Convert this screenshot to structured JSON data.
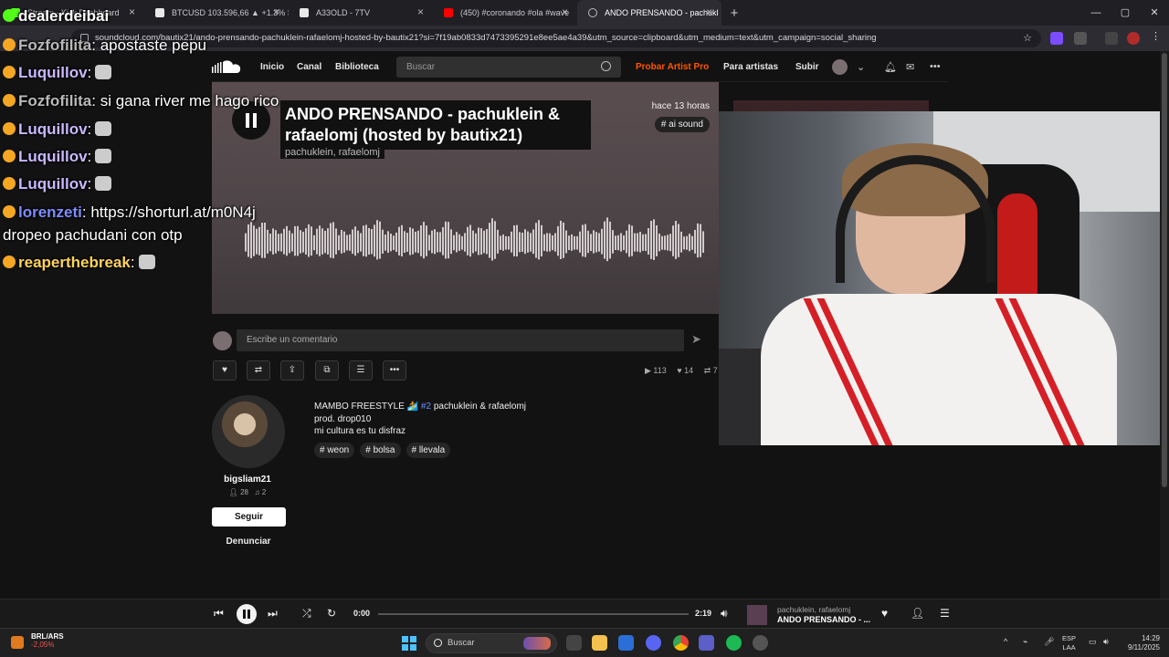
{
  "browser": {
    "tabs": [
      {
        "label": "Stream - Kick Dashboard",
        "icon_color": "#53fc18"
      },
      {
        "label": "BTCUSD 103.596,66 ▲ +1.3% S",
        "icon_color": "#e8e8e8"
      },
      {
        "label": "A33OLD - 7TV",
        "icon_color": "#e8e8e8"
      },
      {
        "label": "(450) #coronando #ola #wave",
        "icon_color": "#ff0000"
      },
      {
        "label": "ANDO PRENSANDO - pachukl",
        "icon_color": "#ff5500"
      }
    ],
    "new_tab": "+",
    "window_controls": [
      "—",
      "▢",
      "✕"
    ],
    "url": "soundcloud.com/bautix21/ando-prensando-pachuklein-rafaelomj-hosted-by-bautix21?si=7f19ab0833d7473395291e8ee5ae4a39&utm_source=clipboard&utm_medium=text&utm_campaign=social_sharing"
  },
  "soundcloud": {
    "nav": {
      "home": "Inicio",
      "feed": "Canal",
      "library": "Biblioteca",
      "search_placeholder": "Buscar",
      "try_pro": "Probar Artist Pro",
      "for_artists": "Para artistas",
      "upload": "Subir"
    },
    "track": {
      "title": "ANDO PRENSANDO - pachuklein & rafaelomj (hosted by bautix21)",
      "artists": "pachuklein, rafaelomj",
      "posted": "hace 13 horas",
      "tag": "# ai sound"
    },
    "comment_placeholder": "Escribe un comentario",
    "stats": {
      "plays": "113",
      "likes": "14",
      "reposts": "7"
    },
    "uploader": {
      "name": "bigsliam21",
      "followers": "28",
      "tracks": "2",
      "follow_label": "Seguir",
      "report_label": "Denunciar"
    },
    "description": {
      "line1_prefix": "MAMBO FREESTYLE 🏄",
      "line1_highlight": "#2",
      "line1_suffix": "pachuklein & rafaelomj",
      "line2": "prod. drop010",
      "line3": "mi cultura es tu disfraz"
    },
    "tags": [
      "# weon",
      "# bolsa",
      "# llevala"
    ]
  },
  "chat": [
    {
      "user": "dealerdeibai",
      "message": "",
      "color": "#ffffff"
    },
    {
      "user": "Fozfofilita",
      "message": ": apostaste pepu",
      "color": "#b9b9b9"
    },
    {
      "user": "Luquillov",
      "message": ":",
      "color": "#c9b8ff"
    },
    {
      "user": "Fozfofilita",
      "message": ": si gana river me hago rico",
      "color": "#b9b9b9"
    },
    {
      "user": "Luquillov",
      "message": ":",
      "color": "#c9b8ff"
    },
    {
      "user": "Luquillov",
      "message": ":",
      "color": "#c9b8ff"
    },
    {
      "user": "Luquillov",
      "message": ":",
      "color": "#c9b8ff"
    },
    {
      "user": "lorenzeti",
      "message": ": https://shorturl.at/m0N4j",
      "color": "#7f8cff"
    },
    {
      "user": "",
      "message": "dropeo pachudani con otp",
      "color": "#ffffff"
    },
    {
      "user": "reaperthebreak",
      "message": ":",
      "color": "#ffd35a"
    }
  ],
  "player": {
    "elapsed": "0:00",
    "duration": "2:19",
    "progress": 0.0,
    "artist": "pachuklein, rafaelomj",
    "title": "ANDO PRENSANDO - ..."
  },
  "taskbar": {
    "stock_name": "BRL/ARS",
    "stock_change": "-2,05%",
    "search_placeholder": "Buscar",
    "lang_line1": "ESP",
    "lang_line2": "LAA",
    "time": "14:29",
    "date": "9/11/2025"
  },
  "colors": {
    "accent": "#ff5500",
    "kick_green": "#53fc18",
    "windows_blue": "#4cc2ff"
  }
}
